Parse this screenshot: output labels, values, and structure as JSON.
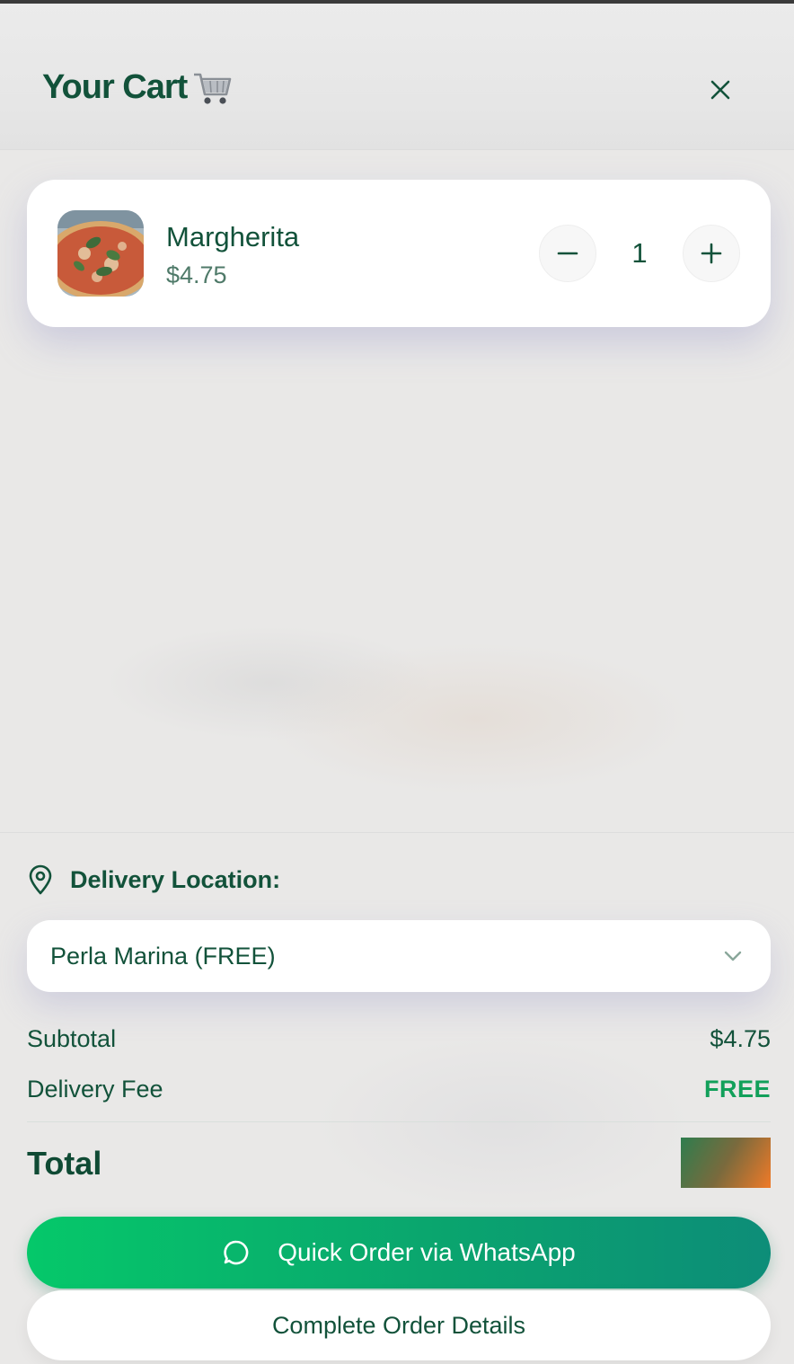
{
  "header": {
    "title": "Your Cart",
    "title_icon": "shopping-cart-emoji",
    "close_icon": "close-icon"
  },
  "cart": {
    "items": [
      {
        "name": "Margherita",
        "price": "$4.75",
        "quantity": "1",
        "image_icon": "pizza-photo"
      }
    ]
  },
  "delivery": {
    "label": "Delivery Location:",
    "icon": "map-pin-icon",
    "selected": "Perla Marina (FREE)"
  },
  "summary": {
    "subtotal_label": "Subtotal",
    "subtotal_value": "$4.75",
    "fee_label": "Delivery Fee",
    "fee_value": "FREE",
    "total_label": "Total"
  },
  "actions": {
    "whatsapp_label": "Quick Order via WhatsApp",
    "complete_label": "Complete Order Details"
  },
  "colors": {
    "brand_green": "#12523a",
    "free_green": "#12a05a",
    "whatsapp_start": "#05c86a",
    "whatsapp_end": "#0d8d78"
  }
}
